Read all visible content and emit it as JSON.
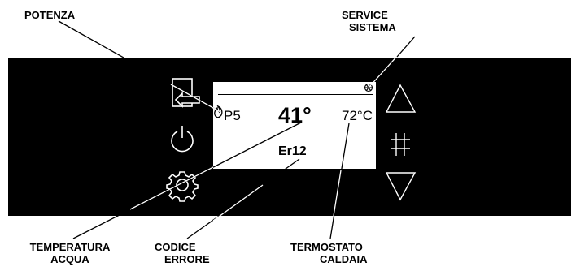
{
  "callouts": {
    "potenza": "POTENZA",
    "service_line1": "SERVICE",
    "service_line2": "SISTEMA",
    "temperatura_line1": "TEMPERATURA",
    "temperatura_line2": "ACQUA",
    "codice_line1": "CODICE",
    "codice_line2": "ERRORE",
    "termostato_line1": "TERMOSTATO",
    "termostato_line2": "CALDAIA"
  },
  "display": {
    "power_level": "P5",
    "water_temperature": "41°",
    "boiler_thermostat": "72°C",
    "error_code": "Er12"
  },
  "colors": {
    "panel": "#000000",
    "lcd": "#ffffff",
    "icons": "#ffffff",
    "text": "#000000"
  },
  "icons": [
    "enter-icon",
    "power-icon",
    "gear-icon",
    "up-arrow-icon",
    "hash-icon",
    "down-arrow-icon",
    "flame-icon",
    "snowflake-icon"
  ]
}
